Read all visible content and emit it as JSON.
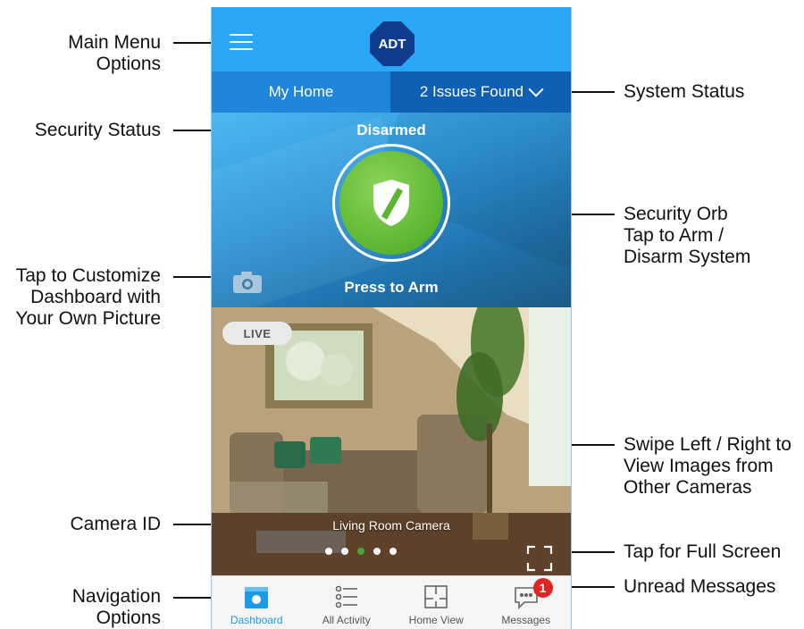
{
  "callouts": {
    "main_menu": [
      "Main Menu",
      "Options"
    ],
    "security_status": "Security Status",
    "customize": [
      "Tap to Customize",
      "Dashboard with",
      "Your Own Picture"
    ],
    "camera_id": "Camera ID",
    "navigation": [
      "Navigation",
      "Options"
    ],
    "system_status": "System Status",
    "security_orb": [
      "Security Orb",
      "Tap to Arm /",
      "Disarm System"
    ],
    "swipe": [
      "Swipe Left / Right to",
      "View Images from",
      "Other Cameras"
    ],
    "full_screen": "Tap for Full Screen",
    "unread": "Unread Messages"
  },
  "app": {
    "logo": "ADT",
    "location_tab": "My Home",
    "issues_tab": "2 Issues Found",
    "security_state": "Disarmed",
    "arm_label": "Press to Arm",
    "live_badge": "LIVE",
    "camera_name": "Living Room Camera",
    "carousel": {
      "count": 5,
      "active_index": 2
    },
    "nav": [
      {
        "label": "Dashboard",
        "icon": "dashboard-icon",
        "active": true
      },
      {
        "label": "All Activity",
        "icon": "activity-list-icon",
        "active": false
      },
      {
        "label": "Home View",
        "icon": "floorplan-icon",
        "active": false
      },
      {
        "label": "Messages",
        "icon": "message-bubble-icon",
        "active": false,
        "badge": "1"
      }
    ]
  },
  "colors": {
    "header_blue": "#2aa7f4",
    "issues_blue": "#0f5fb4",
    "orb_green": "#5bb52f",
    "badge_red": "#e02424",
    "active_nav": "#1e9be8"
  }
}
